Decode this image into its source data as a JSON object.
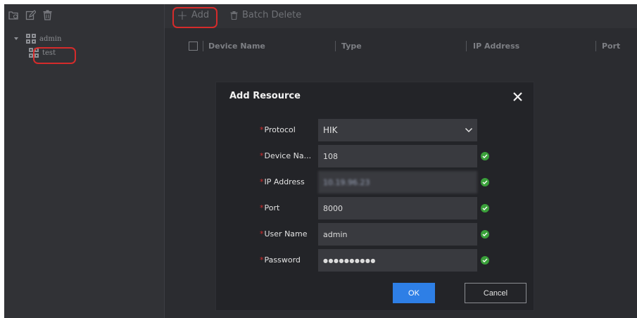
{
  "sidebar": {
    "tree": {
      "root_label": "admin",
      "child_label": "test"
    }
  },
  "toolbar": {
    "add_label": "Add",
    "batch_delete_label": "Batch Delete"
  },
  "table": {
    "columns": [
      "Device Name",
      "Type",
      "IP Address",
      "Port"
    ]
  },
  "dialog": {
    "title": "Add Resource",
    "fields": {
      "protocol": {
        "label": "Protocol",
        "value": "HIK"
      },
      "device_name": {
        "label": "Device Na...",
        "value": "108"
      },
      "ip_address": {
        "label": "IP Address",
        "value": "10.19.96.23"
      },
      "port": {
        "label": "Port",
        "value": "8000"
      },
      "user_name": {
        "label": "User Name",
        "value": "admin"
      },
      "password": {
        "label": "Password",
        "value": "●●●●●●●●●●"
      }
    },
    "required_mark": "*",
    "ok_label": "OK",
    "cancel_label": "Cancel"
  },
  "colors": {
    "accent": "#2e7fe6",
    "valid": "#3aa03a",
    "required": "#d02c2c",
    "highlight": "#d52b2b"
  }
}
